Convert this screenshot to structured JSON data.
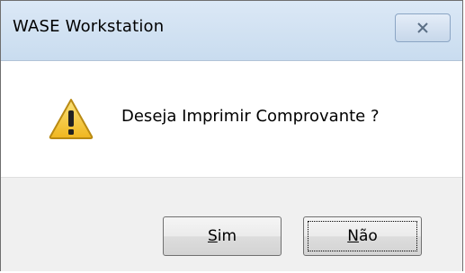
{
  "window": {
    "title": "WASE Workstation",
    "close_icon": "close-icon"
  },
  "message": {
    "icon": "warning-icon",
    "text": "Deseja Imprimir Comprovante ?"
  },
  "buttons": {
    "yes": {
      "accel": "S",
      "rest": "im"
    },
    "no": {
      "accel": "N",
      "rest": "ão",
      "focused": true
    }
  },
  "colors": {
    "warning_fill": "#f5c83a",
    "warning_border": "#b98a13"
  }
}
